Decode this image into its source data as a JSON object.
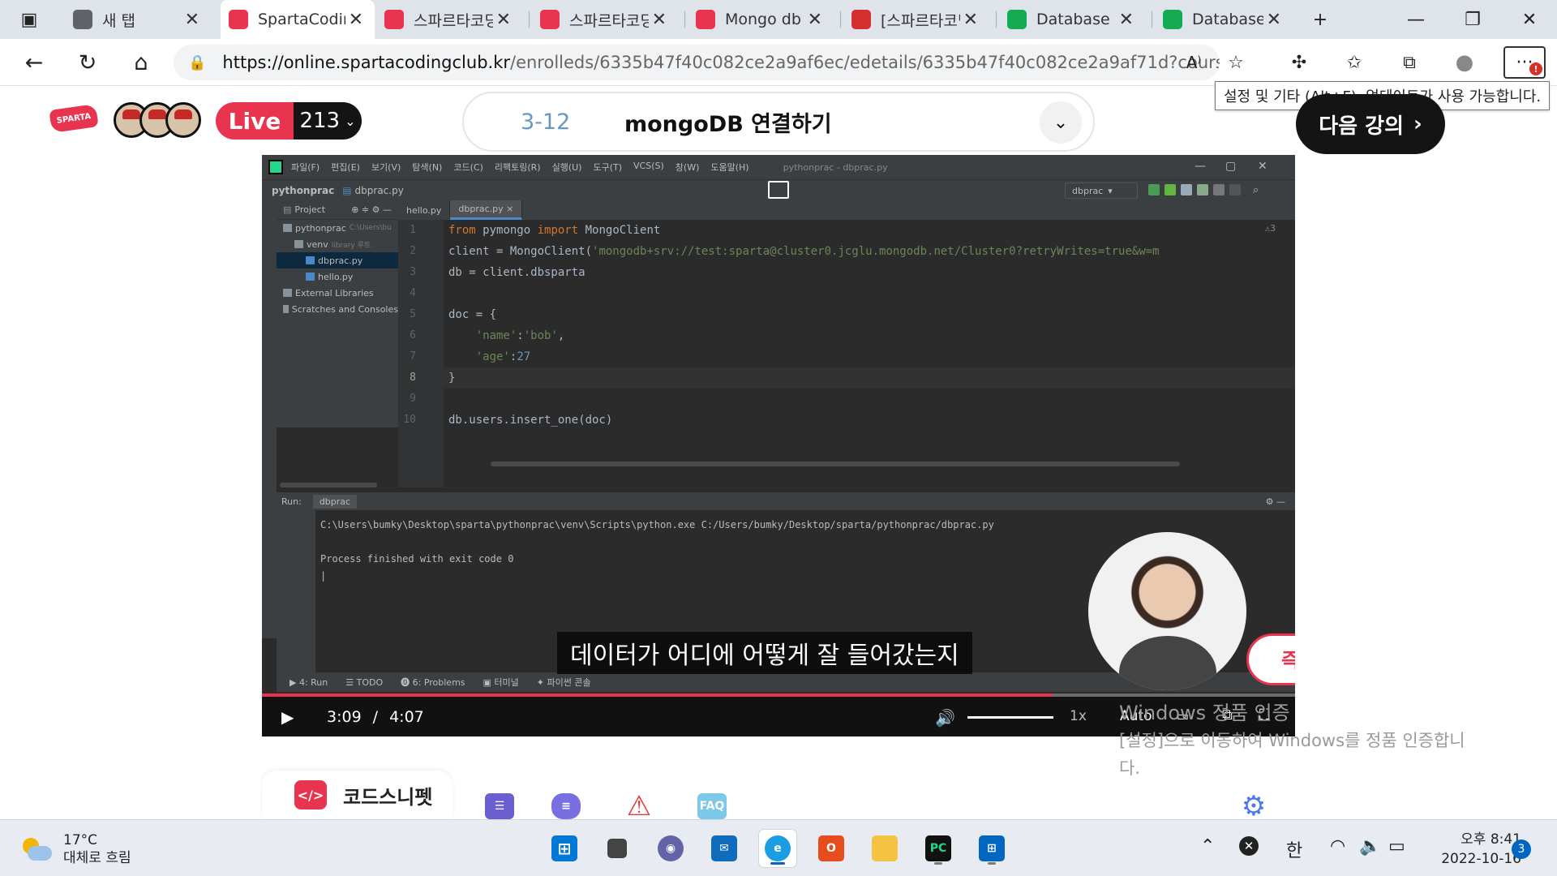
{
  "browser": {
    "tabs": [
      {
        "label": "새 탭",
        "icon": "new-tab-icon",
        "active": false
      },
      {
        "label": "SpartaCoding",
        "icon": "sparta-favicon",
        "active": true
      },
      {
        "label": "스파르타코딩",
        "icon": "sparta-heart-icon",
        "active": false
      },
      {
        "label": "스파르타코딩",
        "icon": "sparta-heart-icon",
        "active": false
      },
      {
        "label": "Mongo db",
        "icon": "sparta-heart-icon",
        "active": false
      },
      {
        "label": "[스파르타코딩",
        "icon": "bookmark-red-icon",
        "active": false
      },
      {
        "label": "Database D",
        "icon": "mongodb-leaf-icon",
        "active": false
      },
      {
        "label": "Database D",
        "icon": "mongodb-leaf-icon",
        "active": false
      }
    ],
    "tab_close_glyph": "✕",
    "new_tab_glyph": "+",
    "url_host": "https://online.spartacodingclub.kr",
    "url_rest": "/enrolleds/6335b47f40c082ce2a9af6ec/edetails/6335b47f40c082ce2a9af71d?course_id=...",
    "tooltip": "설정 및 기타 (Alt+F). 업데이트가 사용 가능합니다.",
    "update_badge": "!"
  },
  "header": {
    "logo_text": "SPARTA",
    "live_label": "Live",
    "live_count": "213",
    "lecture_number": "3-12",
    "lecture_title": "mongoDB 연결하기",
    "next_button": "다음 강의"
  },
  "ide": {
    "menu": [
      "파일(F)",
      "편집(E)",
      "보기(V)",
      "탐색(N)",
      "코드(C)",
      "리팩토링(R)",
      "실행(U)",
      "도구(T)",
      "VCS(S)",
      "창(W)",
      "도움말(H)"
    ],
    "window_title": "pythonprac - dbprac.py",
    "breadcrumb_project": "pythonprac",
    "breadcrumb_file": "dbprac.py",
    "run_config": "dbprac",
    "project_panel_title": "Project",
    "tree": [
      {
        "label": "pythonprac",
        "hint": "C:\\Users\\bu",
        "depth": 0,
        "color": "#87939a"
      },
      {
        "label": "venv",
        "hint": "library 루트",
        "depth": 1,
        "color": "#87939a"
      },
      {
        "label": "dbprac.py",
        "hint": "",
        "depth": 2,
        "color": "#4a88c7"
      },
      {
        "label": "hello.py",
        "hint": "",
        "depth": 2,
        "color": "#4a88c7"
      },
      {
        "label": "External Libraries",
        "hint": "",
        "depth": 0,
        "color": "#87939a"
      },
      {
        "label": "Scratches and Consoles",
        "hint": "",
        "depth": 0,
        "color": "#87939a"
      }
    ],
    "editor_tabs": [
      "hello.py",
      "dbprac.py"
    ],
    "line_numbers": [
      "1",
      "2",
      "3",
      "4",
      "5",
      "6",
      "7",
      "8",
      "9",
      "10"
    ],
    "code": [
      [
        {
          "t": "from ",
          "c": "kw"
        },
        {
          "t": "pymongo ",
          "c": ""
        },
        {
          "t": "import ",
          "c": "kw"
        },
        {
          "t": "MongoClient",
          "c": ""
        }
      ],
      [
        {
          "t": "client = MongoClient(",
          "c": ""
        },
        {
          "t": "'mongodb+srv://test:sparta@cluster0.jcglu.mongodb.net/Cluster0?retryWrites=true&w=m",
          "c": "str"
        }
      ],
      [
        {
          "t": "db = client.dbsparta",
          "c": ""
        }
      ],
      [],
      [
        {
          "t": "doc = {",
          "c": ""
        }
      ],
      [
        {
          "t": "    ",
          "c": ""
        },
        {
          "t": "'name'",
          "c": "str"
        },
        {
          "t": ":",
          "c": ""
        },
        {
          "t": "'bob'",
          "c": "str"
        },
        {
          "t": ",",
          "c": ""
        }
      ],
      [
        {
          "t": "    ",
          "c": ""
        },
        {
          "t": "'age'",
          "c": "str"
        },
        {
          "t": ":",
          "c": ""
        },
        {
          "t": "27",
          "c": "num"
        }
      ],
      [
        {
          "t": "}",
          "c": ""
        }
      ],
      [],
      [
        {
          "t": "db.users.insert_one(doc)",
          "c": ""
        }
      ]
    ],
    "current_line": 8,
    "warning_count": "⚠3",
    "run_label": "Run:",
    "run_tab": "dbprac",
    "console": [
      "C:\\Users\\bumky\\Desktop\\sparta\\pythonprac\\venv\\Scripts\\python.exe C:/Users/bumky/Desktop/sparta/pythonprac/dbprac.py",
      "",
      "Process finished with exit code 0",
      "|"
    ],
    "status_tabs": [
      "▶ 4: Run",
      "☰ TODO",
      "⓿ 6: Problems",
      "▣ 터미널",
      "✦ 파이썬 콘솔"
    ]
  },
  "video": {
    "caption": "데이터가 어디에 어떻게 잘 들어갔는지",
    "quick_answer": "즉문즉답",
    "current_time": "3:09",
    "time_separator": "/",
    "duration": "4:07",
    "progress": 0.7652,
    "speed": "1x",
    "quality": "Auto"
  },
  "tools": {
    "snippet_label": "코드스니펫",
    "faq_label": "FAQ"
  },
  "watermark": {
    "line1": "Windows 정품 인증",
    "line2": "[설정]으로 이동하여 Windows를 정품 인증합니",
    "line3": "다."
  },
  "taskbar": {
    "temperature": "17°C",
    "weather": "대체로 흐림",
    "ime": "한",
    "time": "오후 8:41",
    "date": "2022-10-16",
    "notifications": "3"
  },
  "colors": {
    "accent": "#e8344e",
    "ide_bg": "#2b2b2b",
    "keyword": "#cc7832",
    "string": "#6a8759",
    "number": "#6897bb"
  }
}
